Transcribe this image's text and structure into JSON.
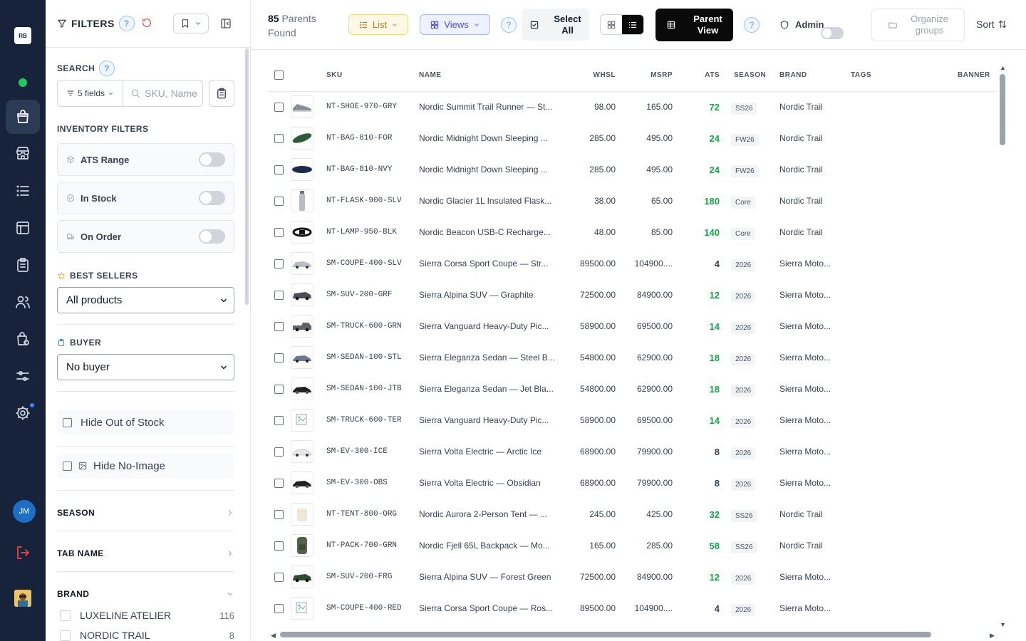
{
  "rail": {
    "logo": "RB",
    "avatar_initials": "JM",
    "items": [
      "inbox-bag-icon",
      "store-icon",
      "list-icon",
      "layout-icon",
      "clipboard-icon",
      "users-icon",
      "catalog-settings-icon",
      "sliders-icon",
      "gear-icon"
    ]
  },
  "sidebar": {
    "title": "FILTERS",
    "search_label": "SEARCH",
    "fields_label": "5 fields",
    "search_placeholder": "SKU, Name",
    "inventory_label": "INVENTORY FILTERS",
    "toggles": [
      {
        "label": "ATS Range",
        "on": false
      },
      {
        "label": "In Stock",
        "on": false
      },
      {
        "label": "On Order",
        "on": false
      }
    ],
    "best_sellers_label": "BEST SELLERS",
    "best_sellers_value": "All products",
    "buyer_label": "BUYER",
    "buyer_value": "No buyer",
    "hide_out_of_stock": "Hide Out of Stock",
    "hide_no_image": "Hide No-Image",
    "season_label": "SEASON",
    "tab_name_label": "TAB NAME",
    "brand_label": "BRAND",
    "brands": [
      {
        "name": "LUXELINE ATELIER",
        "count": "116"
      },
      {
        "name": "NORDIC TRAIL",
        "count": "8"
      }
    ]
  },
  "topbar": {
    "found_count": "85",
    "found_text": "Parents",
    "found_text2": "Found",
    "list_label": "List",
    "views_label": "Views",
    "select_all_line1": "Select",
    "select_all_line2": "All",
    "parent_view_line1": "Parent",
    "parent_view_line2": "View",
    "admin_label": "Admin",
    "organize_line1": "Organize",
    "organize_line2": "groups",
    "sort_label": "Sort"
  },
  "table": {
    "columns": [
      "SKU",
      "NAME",
      "WHSL",
      "MSRP",
      "ATS",
      "SEASON",
      "BRAND",
      "TAGS",
      "BANNER"
    ],
    "rows": [
      {
        "sku": "NT-SHOE-970-GRY",
        "name": "Nordic Summit Trail Runner — St...",
        "whsl": "98.00",
        "msrp": "165.00",
        "ats": "72",
        "season": "SS26",
        "brand": "Nordic Trail",
        "thumb": "shoe-gray"
      },
      {
        "sku": "NT-BAG-810-FOR",
        "name": "Nordic Midnight Down Sleeping ...",
        "whsl": "285.00",
        "msrp": "495.00",
        "ats": "24",
        "season": "FW26",
        "brand": "Nordic Trail",
        "thumb": "bag-green"
      },
      {
        "sku": "NT-BAG-810-NVY",
        "name": "Nordic Midnight Down Sleeping ...",
        "whsl": "285.00",
        "msrp": "495.00",
        "ats": "24",
        "season": "FW26",
        "brand": "Nordic Trail",
        "thumb": "bag-navy"
      },
      {
        "sku": "NT-FLASK-900-SLV",
        "name": "Nordic Glacier 1L Insulated Flask...",
        "whsl": "38.00",
        "msrp": "65.00",
        "ats": "180",
        "season": "Core",
        "brand": "Nordic Trail",
        "thumb": "flask"
      },
      {
        "sku": "NT-LAMP-950-BLK",
        "name": "Nordic Beacon USB-C Recharge...",
        "whsl": "48.00",
        "msrp": "85.00",
        "ats": "140",
        "season": "Core",
        "brand": "Nordic Trail",
        "thumb": "lamp"
      },
      {
        "sku": "SM-COUPE-400-SLV",
        "name": "Sierra Corsa Sport Coupe — Str...",
        "whsl": "89500.00",
        "msrp": "104900....",
        "ats": "4",
        "season": "2026",
        "brand": "Sierra Moto...",
        "thumb": "car-silver"
      },
      {
        "sku": "SM-SUV-200-GRF",
        "name": "Sierra Alpina SUV — Graphite",
        "whsl": "72500.00",
        "msrp": "84900.00",
        "ats": "12",
        "season": "2026",
        "brand": "Sierra Moto...",
        "thumb": "car-graphite"
      },
      {
        "sku": "SM-TRUCK-600-GRN",
        "name": "Sierra Vanguard Heavy-Duty Pic...",
        "whsl": "58900.00",
        "msrp": "69500.00",
        "ats": "14",
        "season": "2026",
        "brand": "Sierra Moto...",
        "thumb": "truck-gray"
      },
      {
        "sku": "SM-SEDAN-100-STL",
        "name": "Sierra Eleganza Sedan — Steel B...",
        "whsl": "54800.00",
        "msrp": "62900.00",
        "ats": "18",
        "season": "2026",
        "brand": "Sierra Moto...",
        "thumb": "car-steel"
      },
      {
        "sku": "SM-SEDAN-100-JTB",
        "name": "Sierra Eleganza Sedan — Jet Bla...",
        "whsl": "54800.00",
        "msrp": "62900.00",
        "ats": "18",
        "season": "2026",
        "brand": "Sierra Moto...",
        "thumb": "car-black"
      },
      {
        "sku": "SM-TRUCK-600-TER",
        "name": "Sierra Vanguard Heavy-Duty Pic...",
        "whsl": "58900.00",
        "msrp": "69500.00",
        "ats": "14",
        "season": "2026",
        "brand": "Sierra Moto...",
        "thumb": "broken"
      },
      {
        "sku": "SM-EV-300-ICE",
        "name": "Sierra Volta Electric — Arctic Ice",
        "whsl": "68900.00",
        "msrp": "79900.00",
        "ats": "8",
        "season": "2026",
        "brand": "Sierra Moto...",
        "thumb": "car-white"
      },
      {
        "sku": "SM-EV-300-OBS",
        "name": "Sierra Volta Electric — Obsidian",
        "whsl": "68900.00",
        "msrp": "79900.00",
        "ats": "8",
        "season": "2026",
        "brand": "Sierra Moto...",
        "thumb": "car-black"
      },
      {
        "sku": "NT-TENT-800-ORG",
        "name": "Nordic Aurora 2-Person Tent — ...",
        "whsl": "245.00",
        "msrp": "425.00",
        "ats": "32",
        "season": "SS26",
        "brand": "Nordic Trail",
        "thumb": "tent"
      },
      {
        "sku": "NT-PACK-700-GRN",
        "name": "Nordic Fjell 65L Backpack — Mo...",
        "whsl": "165.00",
        "msrp": "285.00",
        "ats": "58",
        "season": "SS26",
        "brand": "Nordic Trail",
        "thumb": "pack"
      },
      {
        "sku": "SM-SUV-200-FRG",
        "name": "Sierra Alpina SUV — Forest Green",
        "whsl": "72500.00",
        "msrp": "84900.00",
        "ats": "12",
        "season": "2026",
        "brand": "Sierra Moto...",
        "thumb": "car-green"
      },
      {
        "sku": "SM-COUPE-400-RED",
        "name": "Sierra Corsa Sport Coupe — Ros...",
        "whsl": "89500.00",
        "msrp": "104900....",
        "ats": "4",
        "season": "2026",
        "brand": "Sierra Moto...",
        "thumb": "broken"
      }
    ]
  },
  "colors": {
    "accent": "#0a0a0a",
    "ats_green": "#16a34a",
    "rail_bg": "#16233a",
    "danger": "#ef4444"
  }
}
